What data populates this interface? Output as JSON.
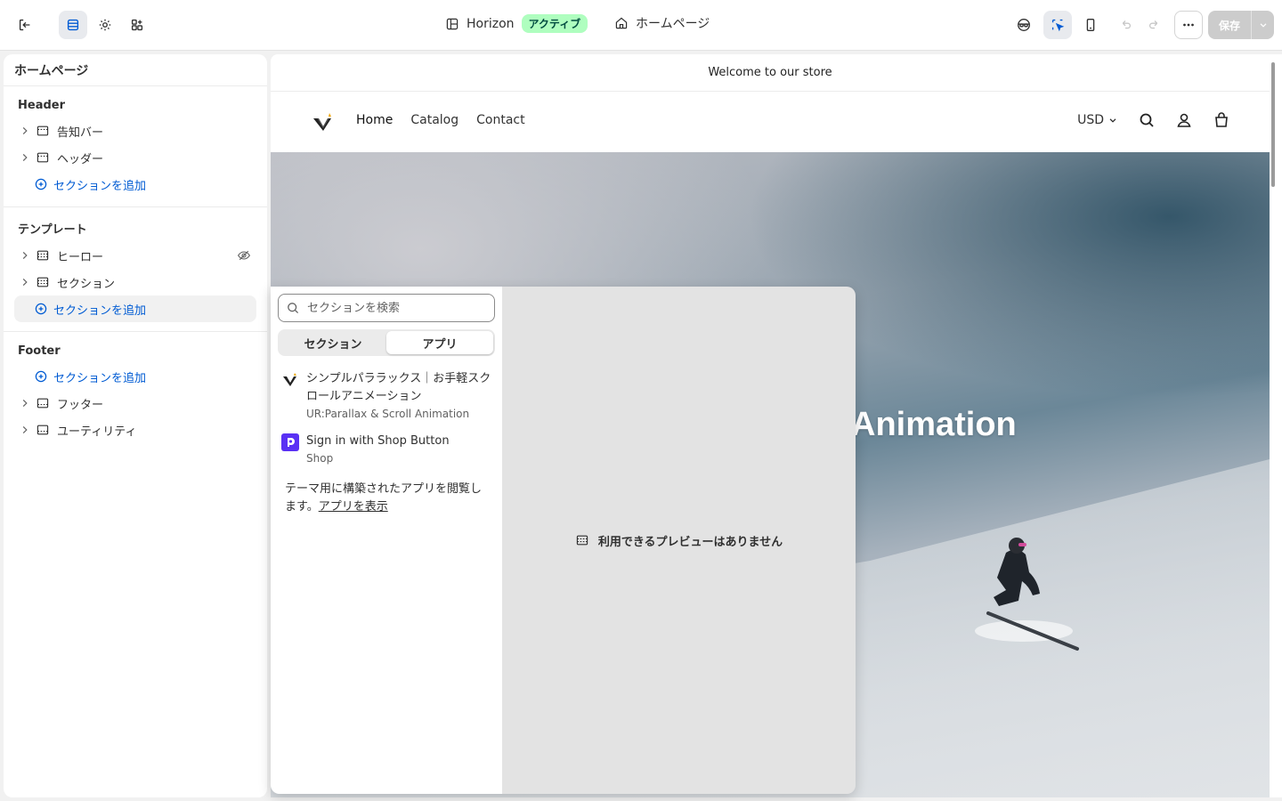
{
  "topbar": {
    "theme_name": "Horizon",
    "theme_status": "アクティブ",
    "page_name": "ホームページ",
    "save_label": "保存"
  },
  "sidebar": {
    "title": "ホームページ",
    "groups": [
      {
        "title": "Header",
        "items": [
          {
            "label": "告知バー"
          },
          {
            "label": "ヘッダー"
          }
        ],
        "add_label": "セクションを追加"
      },
      {
        "title": "テンプレート",
        "items": [
          {
            "label": "ヒーロー"
          },
          {
            "label": "セクション"
          }
        ],
        "add_label": "セクションを追加"
      },
      {
        "title": "Footer",
        "add_label": "セクションを追加",
        "items": [
          {
            "label": "フッター"
          },
          {
            "label": "ユーティリティ"
          }
        ]
      }
    ]
  },
  "preview": {
    "announcement": "Welcome to our store",
    "nav": [
      "Home",
      "Catalog",
      "Contact"
    ],
    "currency": "USD",
    "hero_text": "Animation"
  },
  "popup": {
    "search_placeholder": "セクションを検索",
    "tabs": [
      "セクション",
      "アプリ"
    ],
    "apps": [
      {
        "name": "シンプルパララックス｜お手軽スクロールアニメーション",
        "vendor": "UR:Parallax & Scroll Animation"
      },
      {
        "name": "Sign in with Shop Button",
        "vendor": "Shop"
      }
    ],
    "browse_text": "テーマ用に構築されたアプリを閲覧します。",
    "browse_link": "アプリを表示",
    "no_preview": "利用できるプレビューはありません"
  },
  "colors": {
    "accent": "#005bd3",
    "badge_bg": "#affebf",
    "shop_purple": "#5a31f4"
  }
}
